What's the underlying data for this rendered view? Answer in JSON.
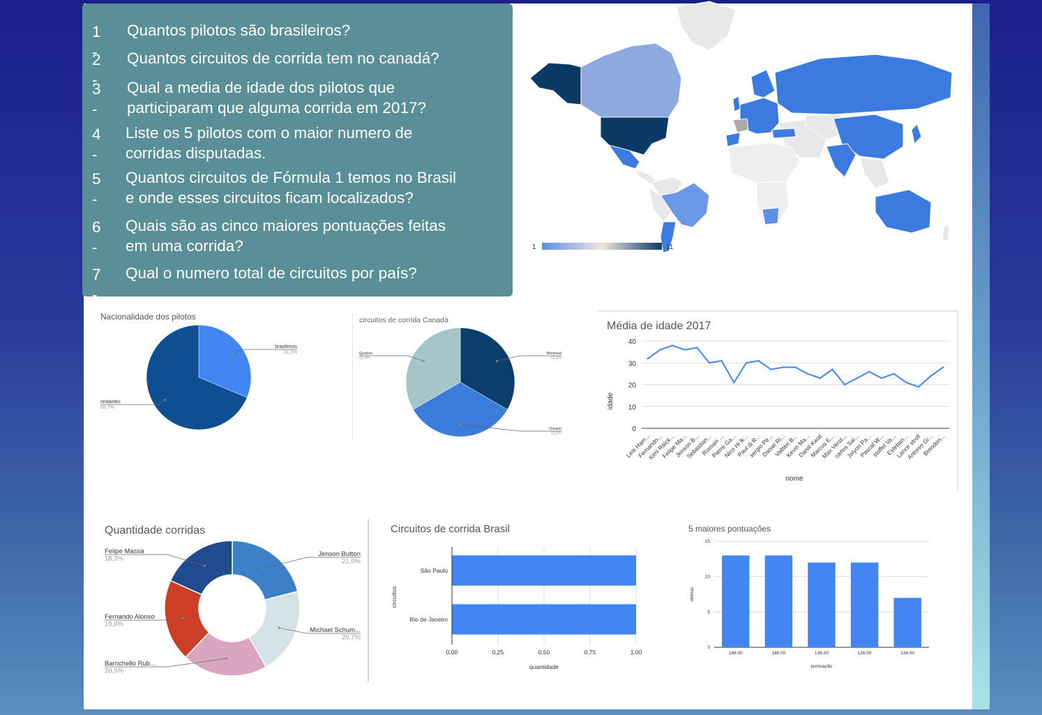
{
  "questions": [
    {
      "num": "1 -",
      "text": "Quantos pilotos são brasileiros?"
    },
    {
      "num": "2 -",
      "text": "Quantos circuitos de corrida tem no canadá?"
    },
    {
      "num": "3 -",
      "text": "Qual a media de idade dos pilotos que\nparticiparam que alguma corrida em 2017?"
    },
    {
      "num": "4 -",
      "text": "Liste os 5 pilotos com o maior numero de\ncorridas disputadas."
    },
    {
      "num": "5 -",
      "text": "Quantos circuitos de Fórmula 1 temos no Brasil\ne onde esses circuitos ficam localizados?"
    },
    {
      "num": "6 -",
      "text": "Quais são as cinco maiores pontuações feitas\nem uma corrida?"
    },
    {
      "num": "7 -",
      "text": "Qual o numero total de circuitos por país?"
    }
  ],
  "map": {
    "legend_min": "1",
    "legend_max": "11",
    "colors": {
      "low": "#5b8fe8",
      "mid": "#efe6dc",
      "high": "#0b3a66"
    }
  },
  "chart_data": [
    {
      "id": "nacionalidade",
      "type": "pie",
      "title": "Nacionalidade dos pilotos",
      "slices": [
        {
          "label": "brasileiros",
          "pct_label": "31,3%",
          "value": 31.3,
          "color": "#4286f4"
        },
        {
          "label": "restantes",
          "pct_label": "68,7%",
          "value": 68.7,
          "color": "#0d4f92"
        }
      ]
    },
    {
      "id": "canada",
      "type": "pie",
      "title": "circuitos de corrida Canadá",
      "slices": [
        {
          "label": "Montreal",
          "pct_label": "33,3%",
          "value": 33.3,
          "color": "#0b3d6b"
        },
        {
          "label": "Ontario",
          "pct_label": "33,3%",
          "value": 33.3,
          "color": "#3a7bdc"
        },
        {
          "label": "Quebec",
          "pct_label": "33,3%",
          "value": 33.3,
          "color": "#a6c5c9"
        }
      ]
    },
    {
      "id": "idade",
      "type": "line",
      "title": "Média de idade 2017",
      "xlabel": "nome",
      "ylabel": "idade",
      "ylim": [
        0,
        40
      ],
      "yticks": [
        0,
        10,
        20,
        30,
        40
      ],
      "categories": [
        "Leis Ham...",
        "Fernando...",
        "Kimi Räick...",
        "Felipe Ma...",
        "Jenson B...",
        "Sebastian...",
        "Romain ...",
        "Pierre Ga...",
        "Nico Hi lk...",
        "Paul di R...",
        "sergio Pé...",
        "Daniel Ri...",
        "Valtteri B...",
        "Kevin Ma...",
        "Daniil Kwat",
        "Marcus E...",
        "Max Verst...",
        "carlos Sai...",
        "Jolyon Pa...",
        "Pascal W...",
        "stoffel Va...",
        "Esteban...",
        "Lance stroll",
        "Antonio Gi...",
        "Brendon..."
      ],
      "values": [
        32,
        36,
        38,
        36,
        37,
        30,
        31,
        21,
        30,
        31,
        27,
        28,
        28,
        25,
        23,
        27,
        20,
        23,
        26,
        23,
        25,
        21,
        19,
        24,
        28
      ],
      "color": "#4286f4"
    },
    {
      "id": "corridas",
      "type": "donut",
      "title": "Quantidade corridas",
      "slices": [
        {
          "label": "Jenson Button",
          "pct_label": "21,0%",
          "value": 21.0,
          "color": "#3b80c9"
        },
        {
          "label": "Michael Schum...",
          "pct_label": "20,7%",
          "value": 20.7,
          "color": "#d4e2e6"
        },
        {
          "label": "Barrichello Rub...",
          "pct_label": "20,5%",
          "value": 20.5,
          "color": "#d9a6bf"
        },
        {
          "label": "Fernando Alonso",
          "pct_label": "19,6%",
          "value": 19.6,
          "color": "#cd3e26"
        },
        {
          "label": "Felipe Massa",
          "pct_label": "18,3%",
          "value": 18.3,
          "color": "#1f4a8c"
        }
      ]
    },
    {
      "id": "brasil",
      "type": "bar",
      "orientation": "horizontal",
      "title": "Circuitos de corrida Brasil",
      "xlabel": "quantidade",
      "ylabel": "circuitos",
      "xlim": [
        0,
        1
      ],
      "xticks": [
        "0,00",
        "0,25",
        "0,50",
        "0,75",
        "1,00"
      ],
      "categories": [
        "São Paulo",
        "Rio de Janeiro"
      ],
      "values": [
        1,
        1
      ],
      "color": "#4286f4"
    },
    {
      "id": "pontuacoes",
      "type": "bar",
      "title": "5 maiores pontuações",
      "xlabel": "pontuação",
      "ylabel": "vitórias",
      "ylim": [
        0,
        15
      ],
      "yticks": [
        0,
        5,
        10,
        15
      ],
      "categories": [
        "148.00",
        "146.00",
        "136.00",
        "136.00",
        "134.00"
      ],
      "values": [
        13,
        13,
        12,
        12,
        7
      ],
      "color": "#4286f4"
    }
  ]
}
